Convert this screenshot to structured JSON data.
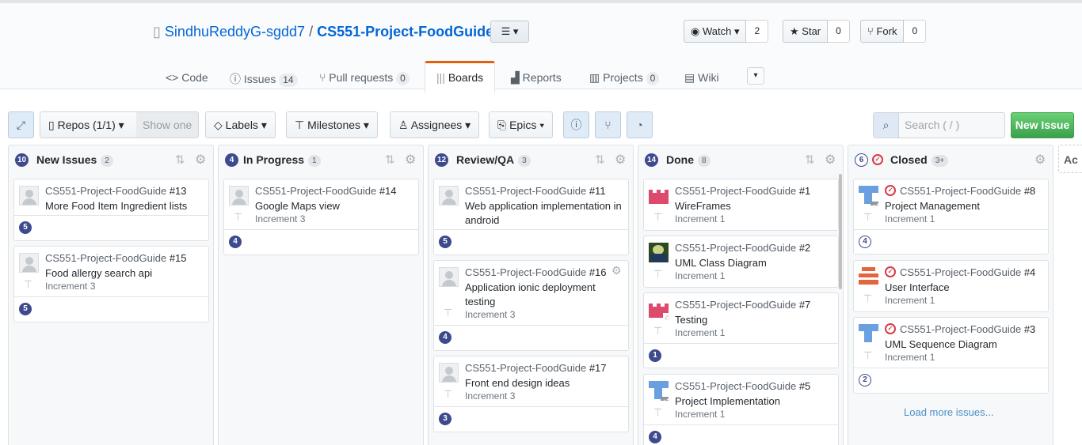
{
  "repo": {
    "owner": "SindhuReddyG-sgdd7",
    "separator": "/",
    "name": "CS551-Project-FoodGuide"
  },
  "social": {
    "watch_label": "Watch",
    "watch_count": "2",
    "star_label": "Star",
    "star_count": "0",
    "fork_label": "Fork",
    "fork_count": "0"
  },
  "tabs": {
    "code": "Code",
    "issues": "Issues",
    "issues_count": "14",
    "pulls": "Pull requests",
    "pulls_count": "0",
    "boards": "Boards",
    "reports": "Reports",
    "projects": "Projects",
    "projects_count": "0",
    "wiki": "Wiki"
  },
  "toolbar": {
    "repos": "Repos (1/1)",
    "show_one": "Show one",
    "labels": "Labels",
    "milestones": "Milestones",
    "assignees": "Assignees",
    "epics": "Epics",
    "search_placeholder": "Search ( / )",
    "new_issue": "New Issue"
  },
  "columns": [
    {
      "points": "10",
      "title": "New Issues",
      "count": "2",
      "cards": [
        {
          "repo": "CS551-Project-FoodGuide",
          "num": "#13",
          "title": "More Food Item Ingredient lists",
          "milestone": "",
          "estimate": "5"
        },
        {
          "repo": "CS551-Project-FoodGuide",
          "num": "#15",
          "title": "Food allergy search api",
          "milestone": "Increment 3",
          "estimate": "5"
        }
      ]
    },
    {
      "points": "4",
      "title": "In Progress",
      "count": "1",
      "cards": [
        {
          "repo": "CS551-Project-FoodGuide",
          "num": "#14",
          "title": "Google Maps view",
          "milestone": "Increment 3",
          "estimate": "4"
        }
      ]
    },
    {
      "points": "12",
      "title": "Review/QA",
      "count": "3",
      "cards": [
        {
          "repo": "CS551-Project-FoodGuide",
          "num": "#11",
          "title": "Web application implementation in android",
          "milestone": "",
          "estimate": "5"
        },
        {
          "repo": "CS551-Project-FoodGuide",
          "num": "#16",
          "title": "Application ionic deployment testing",
          "milestone": "Increment 3",
          "estimate": "4"
        },
        {
          "repo": "CS551-Project-FoodGuide",
          "num": "#17",
          "title": "Front end design ideas",
          "milestone": "Increment 3",
          "estimate": "3"
        }
      ]
    },
    {
      "points": "14",
      "title": "Done",
      "count": "8",
      "cards": [
        {
          "repo": "CS551-Project-FoodGuide",
          "num": "#1",
          "title": "WireFrames",
          "milestone": "Increment 1",
          "estimate": ""
        },
        {
          "repo": "CS551-Project-FoodGuide",
          "num": "#2",
          "title": "UML Class Diagram",
          "milestone": "Increment 1",
          "estimate": ""
        },
        {
          "repo": "CS551-Project-FoodGuide",
          "num": "#7",
          "title": "Testing",
          "milestone": "Increment 1",
          "estimate": "1"
        },
        {
          "repo": "CS551-Project-FoodGuide",
          "num": "#5",
          "title": "Project Implementation",
          "milestone": "Increment 1",
          "estimate": "4",
          "extra_assignees": "+3"
        }
      ]
    },
    {
      "points": "6",
      "title": "Closed",
      "count": "3+",
      "cards": [
        {
          "repo": "CS551-Project-FoodGuide",
          "num": "#8",
          "title": "Project Management",
          "milestone": "Increment 1",
          "estimate": "4",
          "extra_assignees": "+3"
        },
        {
          "repo": "CS551-Project-FoodGuide",
          "num": "#4",
          "title": "User Interface",
          "milestone": "Increment 1",
          "estimate": ""
        },
        {
          "repo": "CS551-Project-FoodGuide",
          "num": "#3",
          "title": "UML Sequence Diagram",
          "milestone": "Increment 1",
          "estimate": "2"
        }
      ],
      "load_more": "Load more issues..."
    }
  ],
  "add_column_label": "Ac",
  "colors": {
    "accent_blue": "#0366d6",
    "estimate_badge": "#3d4a8e",
    "new_issue_green": "#4cb65a",
    "selected_tab_border": "#e36209"
  }
}
